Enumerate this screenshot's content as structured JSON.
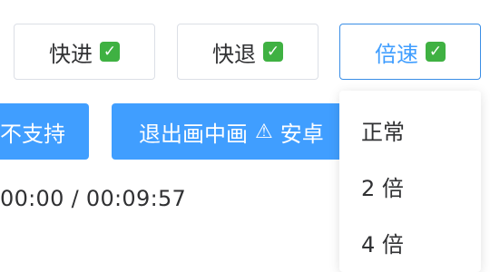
{
  "controls": {
    "forward_label": "快进",
    "rewind_label": "快退",
    "speed_label": "倍速",
    "check_glyph": "✓"
  },
  "actions": {
    "unsupported_label": "不支持",
    "exit_pip_label": "退出画中画",
    "warning_glyph": "⚠",
    "warning_text": "安卓"
  },
  "player": {
    "time_display": "00:00 / 00:09:57"
  },
  "speed_menu": {
    "options": [
      "正常",
      "2 倍",
      "4 倍"
    ]
  },
  "colors": {
    "primary": "#409eff",
    "check": "#3fb142",
    "border": "#dcdfe6"
  }
}
